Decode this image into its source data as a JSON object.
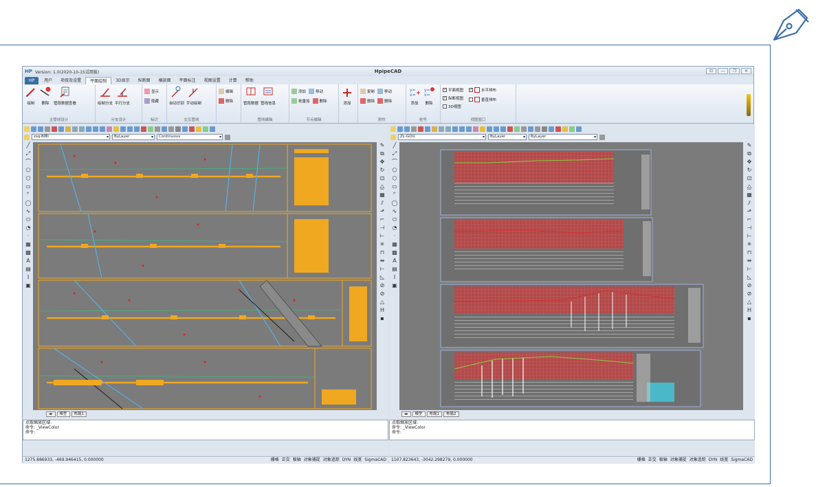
{
  "app": {
    "logo": "HP",
    "version": "Version: 1.0(2020-10-15试用版)",
    "title": "HpipeCAD"
  },
  "window_buttons": [
    "⊡",
    "—",
    "❐",
    "✕"
  ],
  "tabs": [
    "HP",
    "用户",
    "项目及设置",
    "平面绘制",
    "3D显示",
    "纵断面",
    "横剖面",
    "平面标注",
    "视图设置",
    "计算",
    "帮助"
  ],
  "active_tab": "平面绘制",
  "ribbon": {
    "groups": [
      {
        "name": "主管线设计",
        "big": [
          "绘制",
          "删除",
          "管段数据查看"
        ]
      },
      {
        "name": "分支设计",
        "big": [
          "绘制分支",
          "平行分支"
        ]
      },
      {
        "name": "标识",
        "small": [
          "显示",
          "隐藏"
        ]
      },
      {
        "name": "交叉管线",
        "big": [
          "自动识别",
          "手动绘制"
        ]
      },
      {
        "name": "",
        "small": [
          "编辑",
          "删除"
        ]
      },
      {
        "name": "管线编辑",
        "big": [
          "管段数据",
          "管线信息"
        ]
      },
      {
        "name": "节点编辑",
        "small": [
          "添加",
          "批量加",
          "移动",
          "删除"
        ]
      },
      {
        "name": "",
        "big": [
          "添加"
        ]
      },
      {
        "name": "附件",
        "small": [
          "复制",
          "删除",
          "移动",
          "删除"
        ]
      },
      {
        "name": "桩号",
        "big": [
          "添加",
          "删除"
        ]
      },
      {
        "name": "视图窗口",
        "checks": [
          "平面视图",
          "纵断视图",
          "3D视图",
          "水平排布",
          "垂直排布"
        ]
      }
    ]
  },
  "left_pane": {
    "layer": "zsq-B排I",
    "color": "ByLayer",
    "linetype": "Continuous",
    "layout_tabs": [
      "模型",
      "布局1"
    ],
    "cmd_lines": [
      "点取缩放区域:",
      "命令: _ViewColor",
      "命令:"
    ],
    "coords": "1275.886933, -469.946415, 0.000000",
    "flags": [
      "栅格",
      "正交",
      "极轴",
      "对象捕捉",
      "对象追踪",
      "DYN",
      "线宽",
      "SigmaCAD"
    ]
  },
  "right_pane": {
    "layer": "ZL-GOU",
    "color": "ByLayer",
    "linetype": "ByLayer",
    "layout_tabs": [
      "模型",
      "布局1",
      "布局2"
    ],
    "cmd_lines": [
      "点取缩放区域:",
      "命令: _ViewColor",
      "命令:"
    ],
    "coords": "1107.823643, -3042.298279, 0.000000",
    "flags": [
      "栅格",
      "正交",
      "极轴",
      "对象捕捉",
      "对象追踪",
      "DYN",
      "线宽",
      "SigmaCAD"
    ]
  },
  "colors": {
    "frame": "#3a6ea5",
    "canvas": "#7b7b7b",
    "drawing_orange": "#f0a820",
    "profile_red": "#b24a4a"
  }
}
